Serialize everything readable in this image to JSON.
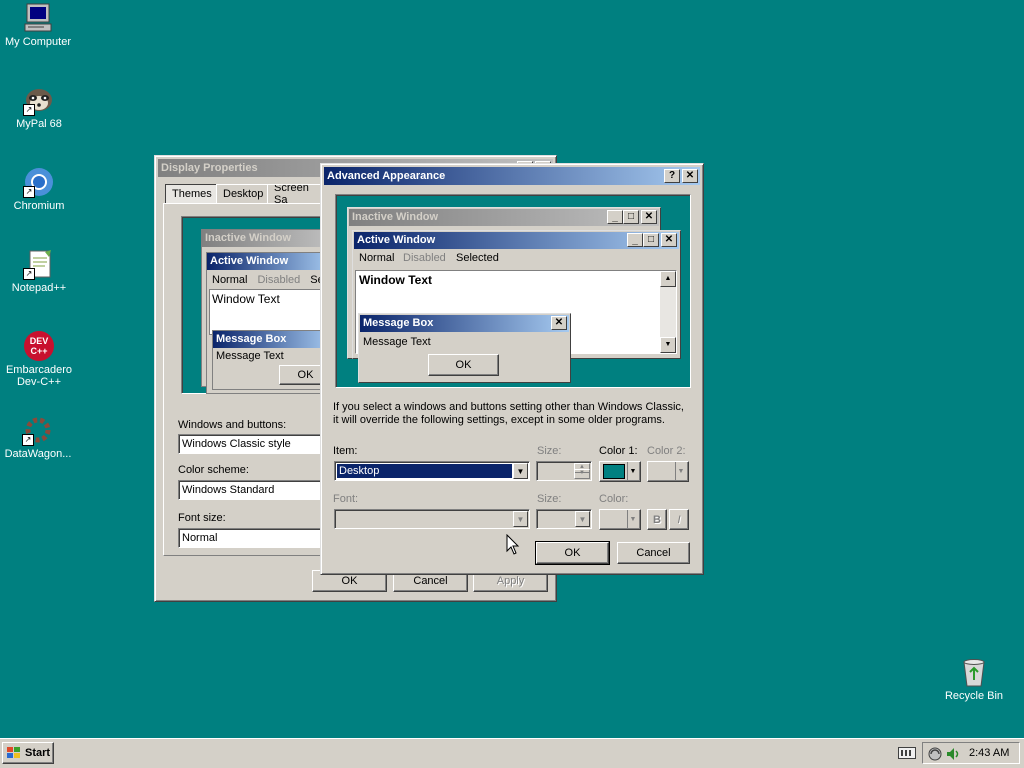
{
  "desktop": {
    "icons": [
      {
        "label": "My Computer"
      },
      {
        "label": "MyPal 68"
      },
      {
        "label": "Chromium"
      },
      {
        "label": "Notepad++"
      },
      {
        "label": "Embarcadero Dev-C++"
      },
      {
        "label": "DataWagon..."
      },
      {
        "label": "Recycle Bin"
      }
    ]
  },
  "display_properties": {
    "title": "Display Properties",
    "tabs": [
      "Themes",
      "Desktop",
      "Screen Sa"
    ],
    "preview": {
      "inactive_title": "Inactive Window",
      "active_title": "Active Window",
      "menu": [
        "Normal",
        "Disabled",
        "Se"
      ],
      "window_text": "Window Text",
      "msg_title": "Message Box",
      "msg_text": "Message Text",
      "ok": "OK"
    },
    "windows_buttons_label": "Windows and buttons:",
    "windows_buttons_value": "Windows Classic style",
    "color_scheme_label": "Color scheme:",
    "color_scheme_value": "Windows Standard",
    "font_size_label": "Font size:",
    "font_size_value": "Normal",
    "buttons": {
      "ok": "OK",
      "cancel": "Cancel",
      "apply": "Apply"
    }
  },
  "advanced": {
    "title": "Advanced Appearance",
    "help_btn": "?",
    "close_btn": "✕",
    "preview": {
      "inactive_title": "Inactive Window",
      "active_title": "Active Window",
      "menu_normal": "Normal",
      "menu_disabled": "Disabled",
      "menu_selected": "Selected",
      "window_text": "Window Text",
      "msg_title": "Message Box",
      "msg_text": "Message Text",
      "ok": "OK"
    },
    "info_line1": "If you select a windows and buttons setting other than Windows Classic,",
    "info_line2": "it will override the following settings, except in some older programs.",
    "item_label": "Item:",
    "item_value": "Desktop",
    "size_label": "Size:",
    "color1_label": "Color 1:",
    "color2_label": "Color 2:",
    "font_label": "Font:",
    "size2_label": "Size:",
    "color_label": "Color:",
    "bold": "B",
    "italic": "I",
    "color1_value": "#008080",
    "buttons": {
      "ok": "OK",
      "cancel": "Cancel"
    }
  },
  "taskbar": {
    "start": "Start",
    "clock": "2:43 AM"
  }
}
